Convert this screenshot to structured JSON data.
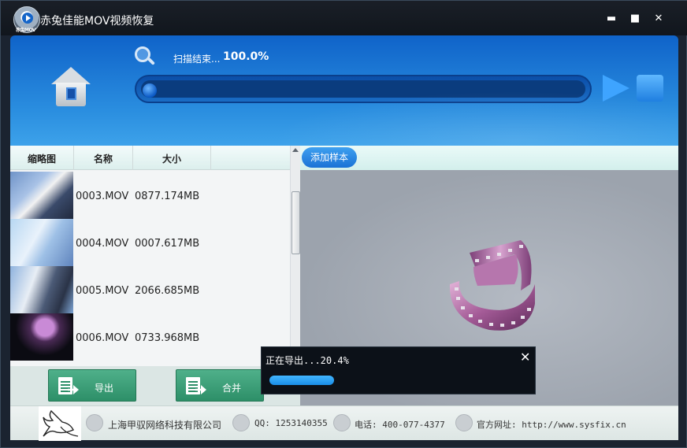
{
  "window": {
    "title": "赤兔佳能MOV视频恢复",
    "logo_text": "赤兔MOV",
    "minimize": "▬",
    "maximize": "■",
    "close": "✕"
  },
  "scan": {
    "status": "扫描结束...",
    "percent": "100.0%"
  },
  "file_list": {
    "headers": {
      "thumbnail": "缩略图",
      "name": "名称",
      "size": "大小"
    },
    "rows": [
      {
        "name": "0003.MOV",
        "size": "0877.174MB"
      },
      {
        "name": "0004.MOV",
        "size": "0007.617MB"
      },
      {
        "name": "0005.MOV",
        "size": "2066.685MB"
      },
      {
        "name": "0006.MOV",
        "size": "0733.968MB"
      }
    ]
  },
  "buttons": {
    "export": "导出",
    "merge": "合并",
    "add_sample": "添加样本"
  },
  "export_dialog": {
    "text": "正在导出...20.4%",
    "progress": 0.204,
    "close": "✕"
  },
  "footer": {
    "company": "上海甲驭网络科技有限公司",
    "qq": "QQ: 1253140355",
    "phone": "电话: 400-077-4377",
    "website": "官方网址: http://www.sysfix.cn"
  },
  "icons": [
    "home-icon",
    "search-icon",
    "play-icon",
    "stop-icon",
    "export-icon",
    "merge-icon",
    "film-reel-icon",
    "horse-logo",
    "company-icon",
    "qq-icon",
    "phone-icon",
    "globe-icon"
  ]
}
